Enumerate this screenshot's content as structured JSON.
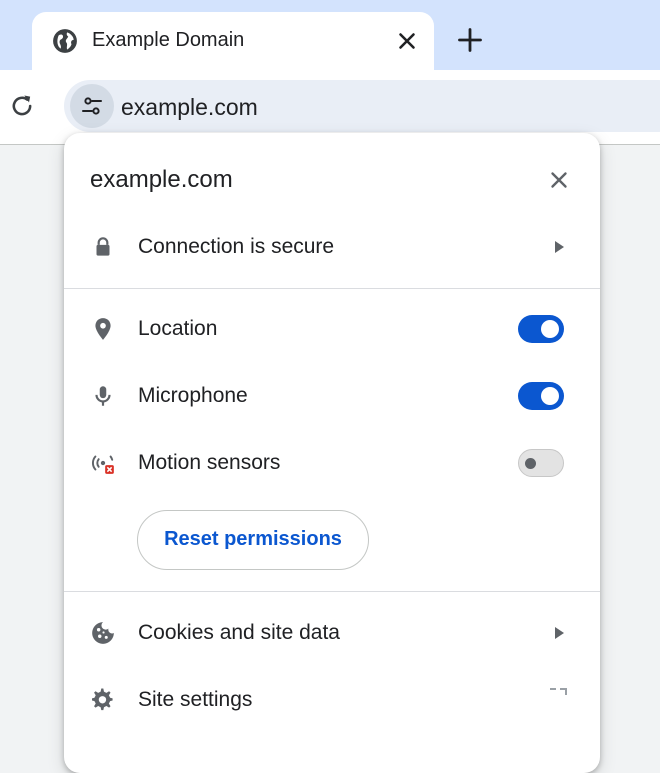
{
  "tab": {
    "title": "Example Domain",
    "favicon": "globe-icon"
  },
  "toolbar": {
    "url": "example.com"
  },
  "popup": {
    "domain": "example.com",
    "connection": "Connection is secure",
    "permissions": [
      {
        "label": "Location",
        "icon": "location-pin-icon",
        "enabled": true
      },
      {
        "label": "Microphone",
        "icon": "microphone-icon",
        "enabled": true
      },
      {
        "label": "Motion sensors",
        "icon": "motion-sensors-blocked-icon",
        "enabled": false
      }
    ],
    "reset_label": "Reset permissions",
    "cookies": "Cookies and site data",
    "site_settings": "Site settings"
  },
  "colors": {
    "accent": "#0b57d0",
    "tabstrip": "#d3e3fd",
    "omnibox": "#e9eef6"
  }
}
